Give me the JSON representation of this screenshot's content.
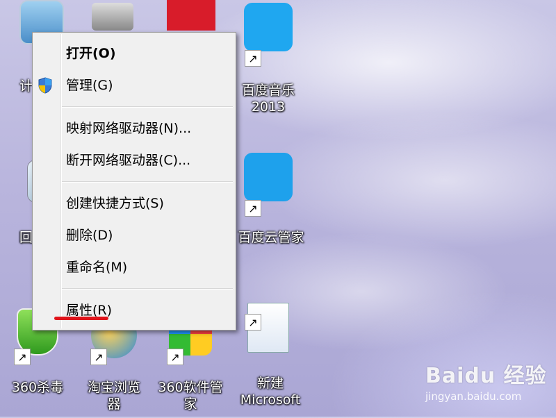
{
  "context_menu": {
    "items": [
      {
        "label": "打开(O)"
      },
      {
        "label": "管理(G)"
      },
      {
        "label": "映射网络驱动器(N)..."
      },
      {
        "label": "断开网络驱动器(C)..."
      },
      {
        "label": "创建快捷方式(S)"
      },
      {
        "label": "删除(D)"
      },
      {
        "label": "重命名(M)"
      },
      {
        "label": "属性(R)"
      }
    ]
  },
  "desktop_icons": [
    {
      "label": "计"
    },
    {
      "label": "回"
    },
    {
      "label": "360杀毒"
    },
    {
      "label": "淘宝浏览器"
    },
    {
      "label": "360软件管家"
    },
    {
      "label": "百度音乐\n2013"
    },
    {
      "label": "百度云管家"
    },
    {
      "label": "新建\nMicrosoft"
    }
  ],
  "watermark": {
    "main": "Baidu 经验",
    "sub": "jingyan.baidu.com"
  },
  "colors": {
    "highlight": "#e0141b",
    "menu_bg": "#f0f0f0"
  }
}
